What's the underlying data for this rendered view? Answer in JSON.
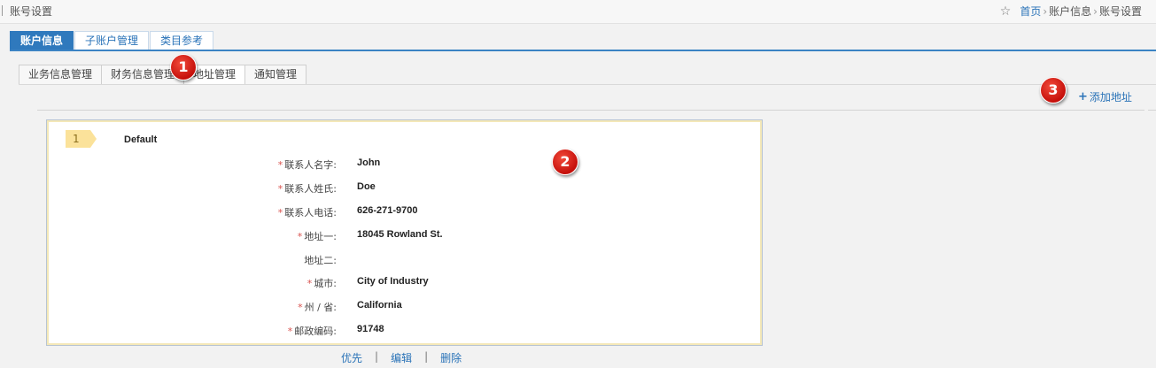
{
  "header": {
    "title": "账号设置",
    "breadcrumb": [
      "首页",
      "账户信息",
      "账号设置"
    ]
  },
  "main_tabs": [
    {
      "label": "账户信息",
      "active": true
    },
    {
      "label": "子账户管理",
      "active": false
    },
    {
      "label": "类目参考",
      "active": false
    }
  ],
  "sub_tabs": [
    {
      "label": "业务信息管理",
      "active": false
    },
    {
      "label": "财务信息管理",
      "active": false
    },
    {
      "label": "地址管理",
      "active": true
    },
    {
      "label": "通知管理",
      "active": false
    }
  ],
  "add_address_label": "添加地址",
  "address_card": {
    "index": "1",
    "tag": "Default",
    "fields": [
      {
        "label": "联系人名字:",
        "required": true,
        "value": "John"
      },
      {
        "label": "联系人姓氏:",
        "required": true,
        "value": "Doe"
      },
      {
        "label": "联系人电话:",
        "required": true,
        "value": "626-271-9700"
      },
      {
        "label": "地址一:",
        "required": true,
        "value": "18045 Rowland St."
      },
      {
        "label": "地址二:",
        "required": false,
        "value": ""
      },
      {
        "label": "城市:",
        "required": true,
        "value": "City of Industry"
      },
      {
        "label": "州 / 省:",
        "required": true,
        "value": "California"
      },
      {
        "label": "邮政编码:",
        "required": true,
        "value": "91748"
      }
    ]
  },
  "actions": [
    "优先",
    "编辑",
    "删除"
  ],
  "markers": [
    "1",
    "2",
    "3"
  ],
  "colors": {
    "accent": "#2f79bd",
    "link": "#2a73b8",
    "marker": "#d0140d",
    "required": "#d9534f"
  }
}
